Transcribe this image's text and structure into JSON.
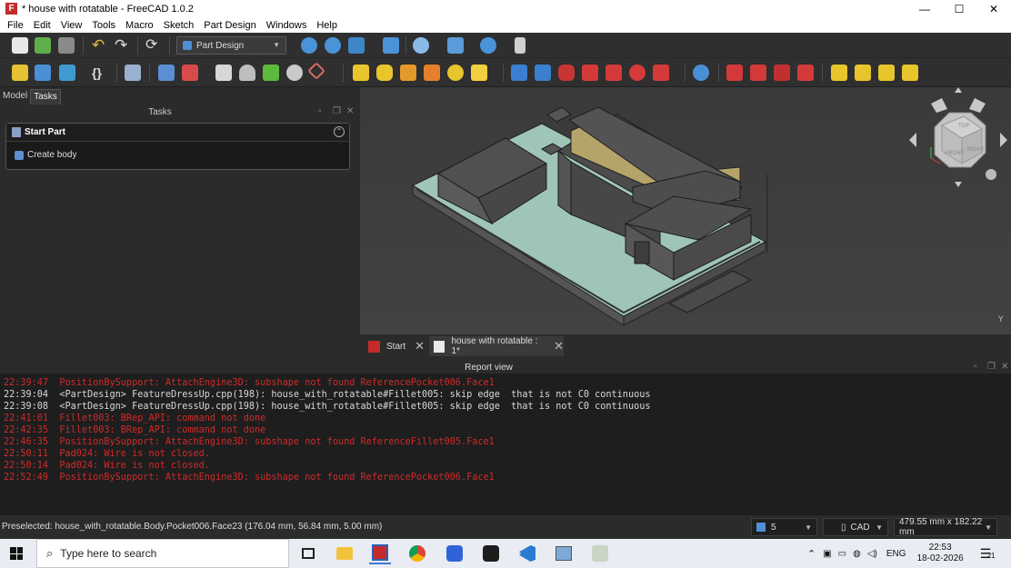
{
  "window": {
    "title": "* house with rotatable - FreeCAD 1.0.2",
    "controls": [
      "—",
      "☐",
      "✕"
    ]
  },
  "menu": [
    "File",
    "Edit",
    "View",
    "Tools",
    "Macro",
    "Sketch",
    "Part Design",
    "Windows",
    "Help"
  ],
  "toolbar": {
    "workbench": "Part Design"
  },
  "left_panel": {
    "tabs": [
      "Model",
      "Tasks"
    ],
    "active_tab": "Tasks",
    "tasks_title": "Tasks",
    "task_box": {
      "header": "Start Part",
      "action": "Create body"
    }
  },
  "viewcube": {
    "faces": [
      "TOP",
      "FRONT",
      "RIGHT"
    ],
    "axis": "Y"
  },
  "doc_tabs": [
    {
      "label": "Start"
    },
    {
      "label": "house with rotatable : 1*"
    }
  ],
  "report": {
    "title": "Report view",
    "lines": [
      {
        "text": "22:39:47  PositionBySupport: AttachEngine3D: subshape not found ReferencePocket006.Face1",
        "type": "err"
      },
      {
        "text": "22:39:04  <PartDesign> FeatureDressUp.cpp(198): house_with_rotatable#Fillet005: skip edge  that is not C0 continuous",
        "type": "log"
      },
      {
        "text": "22:39:08  <PartDesign> FeatureDressUp.cpp(198): house_with_rotatable#Fillet005: skip edge  that is not C0 continuous",
        "type": "log"
      },
      {
        "text": "22:41:01  Fillet003: BRep_API: command not done",
        "type": "err"
      },
      {
        "text": "22:42:35  Fillet003: BRep_API: command not done",
        "type": "err"
      },
      {
        "text": "22:46:35  PositionBySupport: AttachEngine3D: subshape not found ReferenceFillet005.Face1",
        "type": "err"
      },
      {
        "text": "22:50:11  Pad024: Wire is not closed.",
        "type": "err"
      },
      {
        "text": "22:50:14  Pad024: Wire is not closed.",
        "type": "err"
      },
      {
        "text": "22:52:49  PositionBySupport: AttachEngine3D: subshape not found ReferencePocket006.Face1",
        "type": "err"
      }
    ]
  },
  "status": {
    "message": "Preselected: house_with_rotatable.Body.Pocket006.Face23 (176.04 mm, 56.84 mm, 5.00 mm)",
    "layer_count": "5",
    "nav_style": "CAD",
    "dimensions": "479.55 mm x 182.22 mm"
  },
  "taskbar": {
    "search_placeholder": "Type here to search",
    "language": "ENG",
    "time": "22:53",
    "date": "18-02-2026",
    "notifications": "21"
  }
}
